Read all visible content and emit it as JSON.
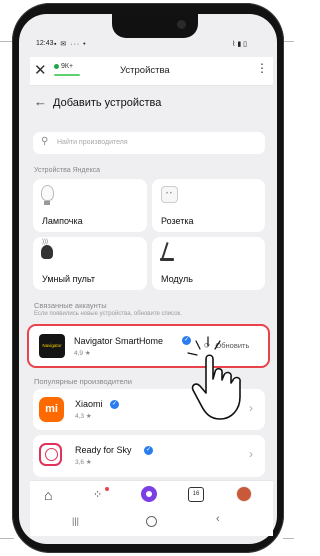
{
  "status": {
    "time": "12:43",
    "right": "⋯ ∎"
  },
  "topbar": {
    "title": "Устройства",
    "brand": "9К+"
  },
  "header": {
    "title": "Добавить устройства"
  },
  "search": {
    "placeholder": "Найти производителя"
  },
  "yandex_section": {
    "title": "Устройства Яндекса"
  },
  "yandex_devices": [
    {
      "label": "Лампочка",
      "icon": "bulb-icon"
    },
    {
      "label": "Розетка",
      "icon": "socket-icon"
    },
    {
      "label": "Умный пульт",
      "icon": "remote-icon"
    },
    {
      "label": "Модуль",
      "icon": "module-icon"
    }
  ],
  "linked": {
    "title": "Связанные аккаунты",
    "subtitle": "Если появились новые устройства, обновите список.",
    "account_name": "Navigator SmartHome",
    "account_rating": "4,9 ★",
    "logo_text": "Navigator",
    "refresh_label": "Обновить"
  },
  "popular": {
    "title": "Популярные производители",
    "items": [
      {
        "name": "Xiaomi",
        "rating": "4,3 ★",
        "logo": "mi",
        "color": "#ff6a00"
      },
      {
        "name": "Ready for Sky",
        "rating": "3,6 ★",
        "logo": "rfs-icon",
        "color": "#e0325a"
      }
    ]
  },
  "tabbar": {
    "tab_badge": "16"
  },
  "colors": {
    "highlight": "#e8434b",
    "accent": "#7b3fe4",
    "link": "#2a7df0"
  }
}
